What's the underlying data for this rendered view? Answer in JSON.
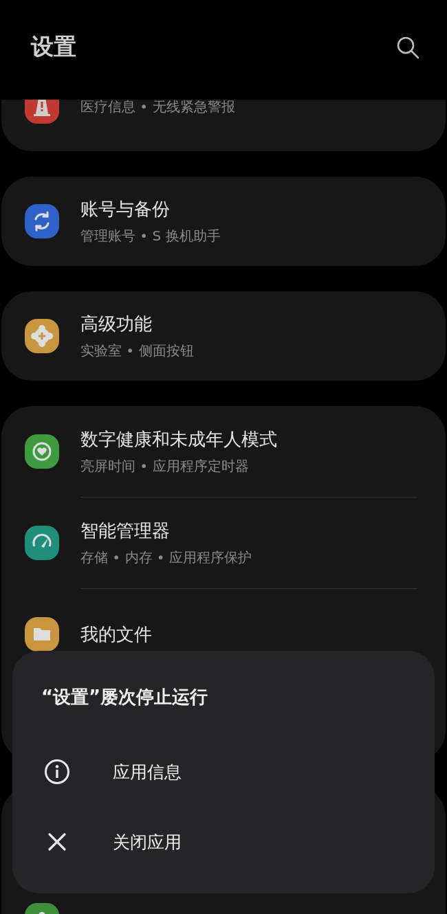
{
  "header": {
    "title": "设置"
  },
  "groups": [
    {
      "rows": [
        {
          "subtitle": "医疗信息 • 无线紧急警报",
          "color": "#c13a32"
        }
      ]
    },
    {
      "rows": [
        {
          "title": "账号与备份",
          "subtitle": "管理账号 • S 换机助手",
          "color": "#2f62c8"
        }
      ]
    },
    {
      "rows": [
        {
          "title": "高级功能",
          "subtitle": "实验室 • 侧面按钮",
          "color": "#c8963e"
        }
      ]
    },
    {
      "rows": [
        {
          "title": "数字健康和未成年人模式",
          "subtitle": "亮屏时间 • 应用程序定时器",
          "color": "#3d9a3f"
        },
        {
          "title": "智能管理器",
          "subtitle": "存储 • 内存 • 应用程序保护",
          "color": "#1f8f7c"
        },
        {
          "title": "我的文件",
          "color": "#c8963e"
        }
      ]
    },
    {
      "rows": [
        {
          "color": "#3d8f3a"
        }
      ]
    }
  ],
  "dialog": {
    "title": "“设置”屡次停止运行",
    "items": [
      {
        "label": "应用信息"
      },
      {
        "label": "关闭应用"
      }
    ]
  }
}
